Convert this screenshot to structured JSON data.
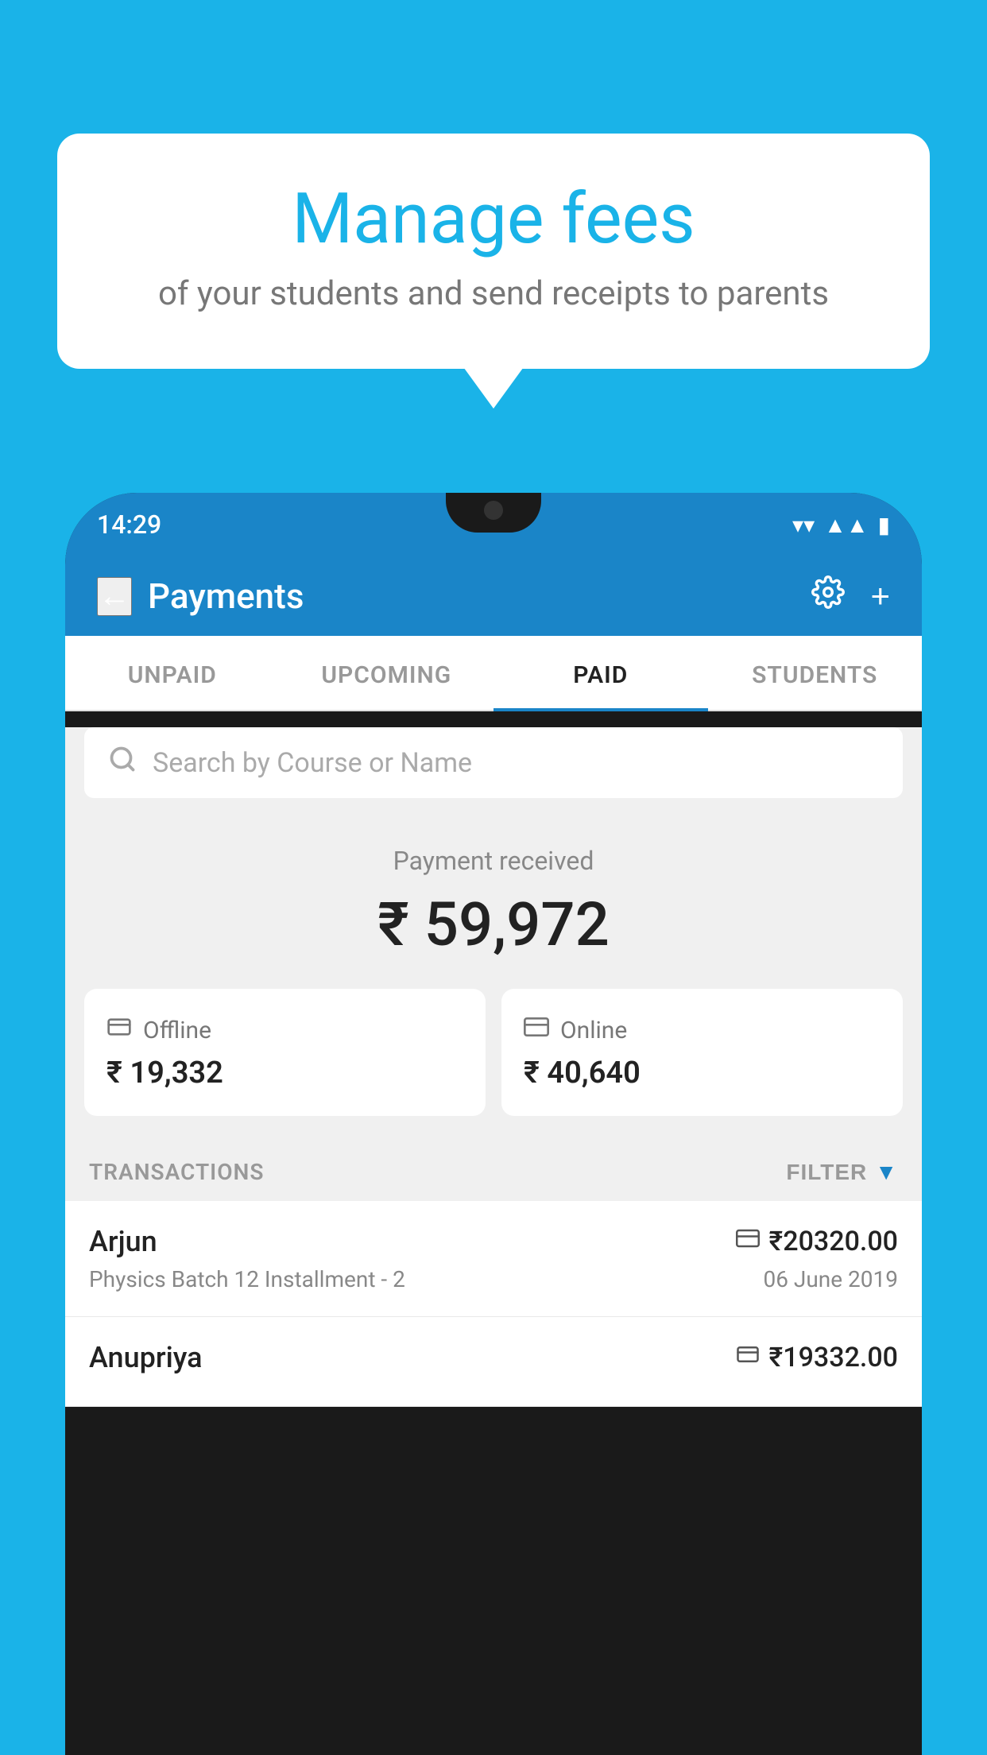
{
  "page": {
    "bg_color": "#1ab3e8"
  },
  "bubble": {
    "title": "Manage fees",
    "subtitle": "of your students and send receipts to parents"
  },
  "status_bar": {
    "time": "14:29",
    "icons": [
      "wifi",
      "signal",
      "battery"
    ]
  },
  "header": {
    "title": "Payments",
    "back_label": "←",
    "settings_label": "⚙",
    "add_label": "+"
  },
  "tabs": [
    {
      "id": "unpaid",
      "label": "UNPAID",
      "active": false
    },
    {
      "id": "upcoming",
      "label": "UPCOMING",
      "active": false
    },
    {
      "id": "paid",
      "label": "PAID",
      "active": true
    },
    {
      "id": "students",
      "label": "STUDENTS",
      "active": false
    }
  ],
  "search": {
    "placeholder": "Search by Course or Name"
  },
  "payment_received": {
    "label": "Payment received",
    "amount": "₹ 59,972"
  },
  "payment_cards": [
    {
      "id": "offline",
      "icon": "💳",
      "label": "Offline",
      "amount": "₹ 19,332"
    },
    {
      "id": "online",
      "icon": "💳",
      "label": "Online",
      "amount": "₹ 40,640"
    }
  ],
  "transactions": {
    "label": "TRANSACTIONS",
    "filter_label": "FILTER",
    "rows": [
      {
        "name": "Arjun",
        "icon": "card",
        "amount": "₹20320.00",
        "course": "Physics Batch 12 Installment - 2",
        "date": "06 June 2019"
      },
      {
        "name": "Anupriya",
        "icon": "offline",
        "amount": "₹19332.00",
        "course": "",
        "date": ""
      }
    ]
  }
}
